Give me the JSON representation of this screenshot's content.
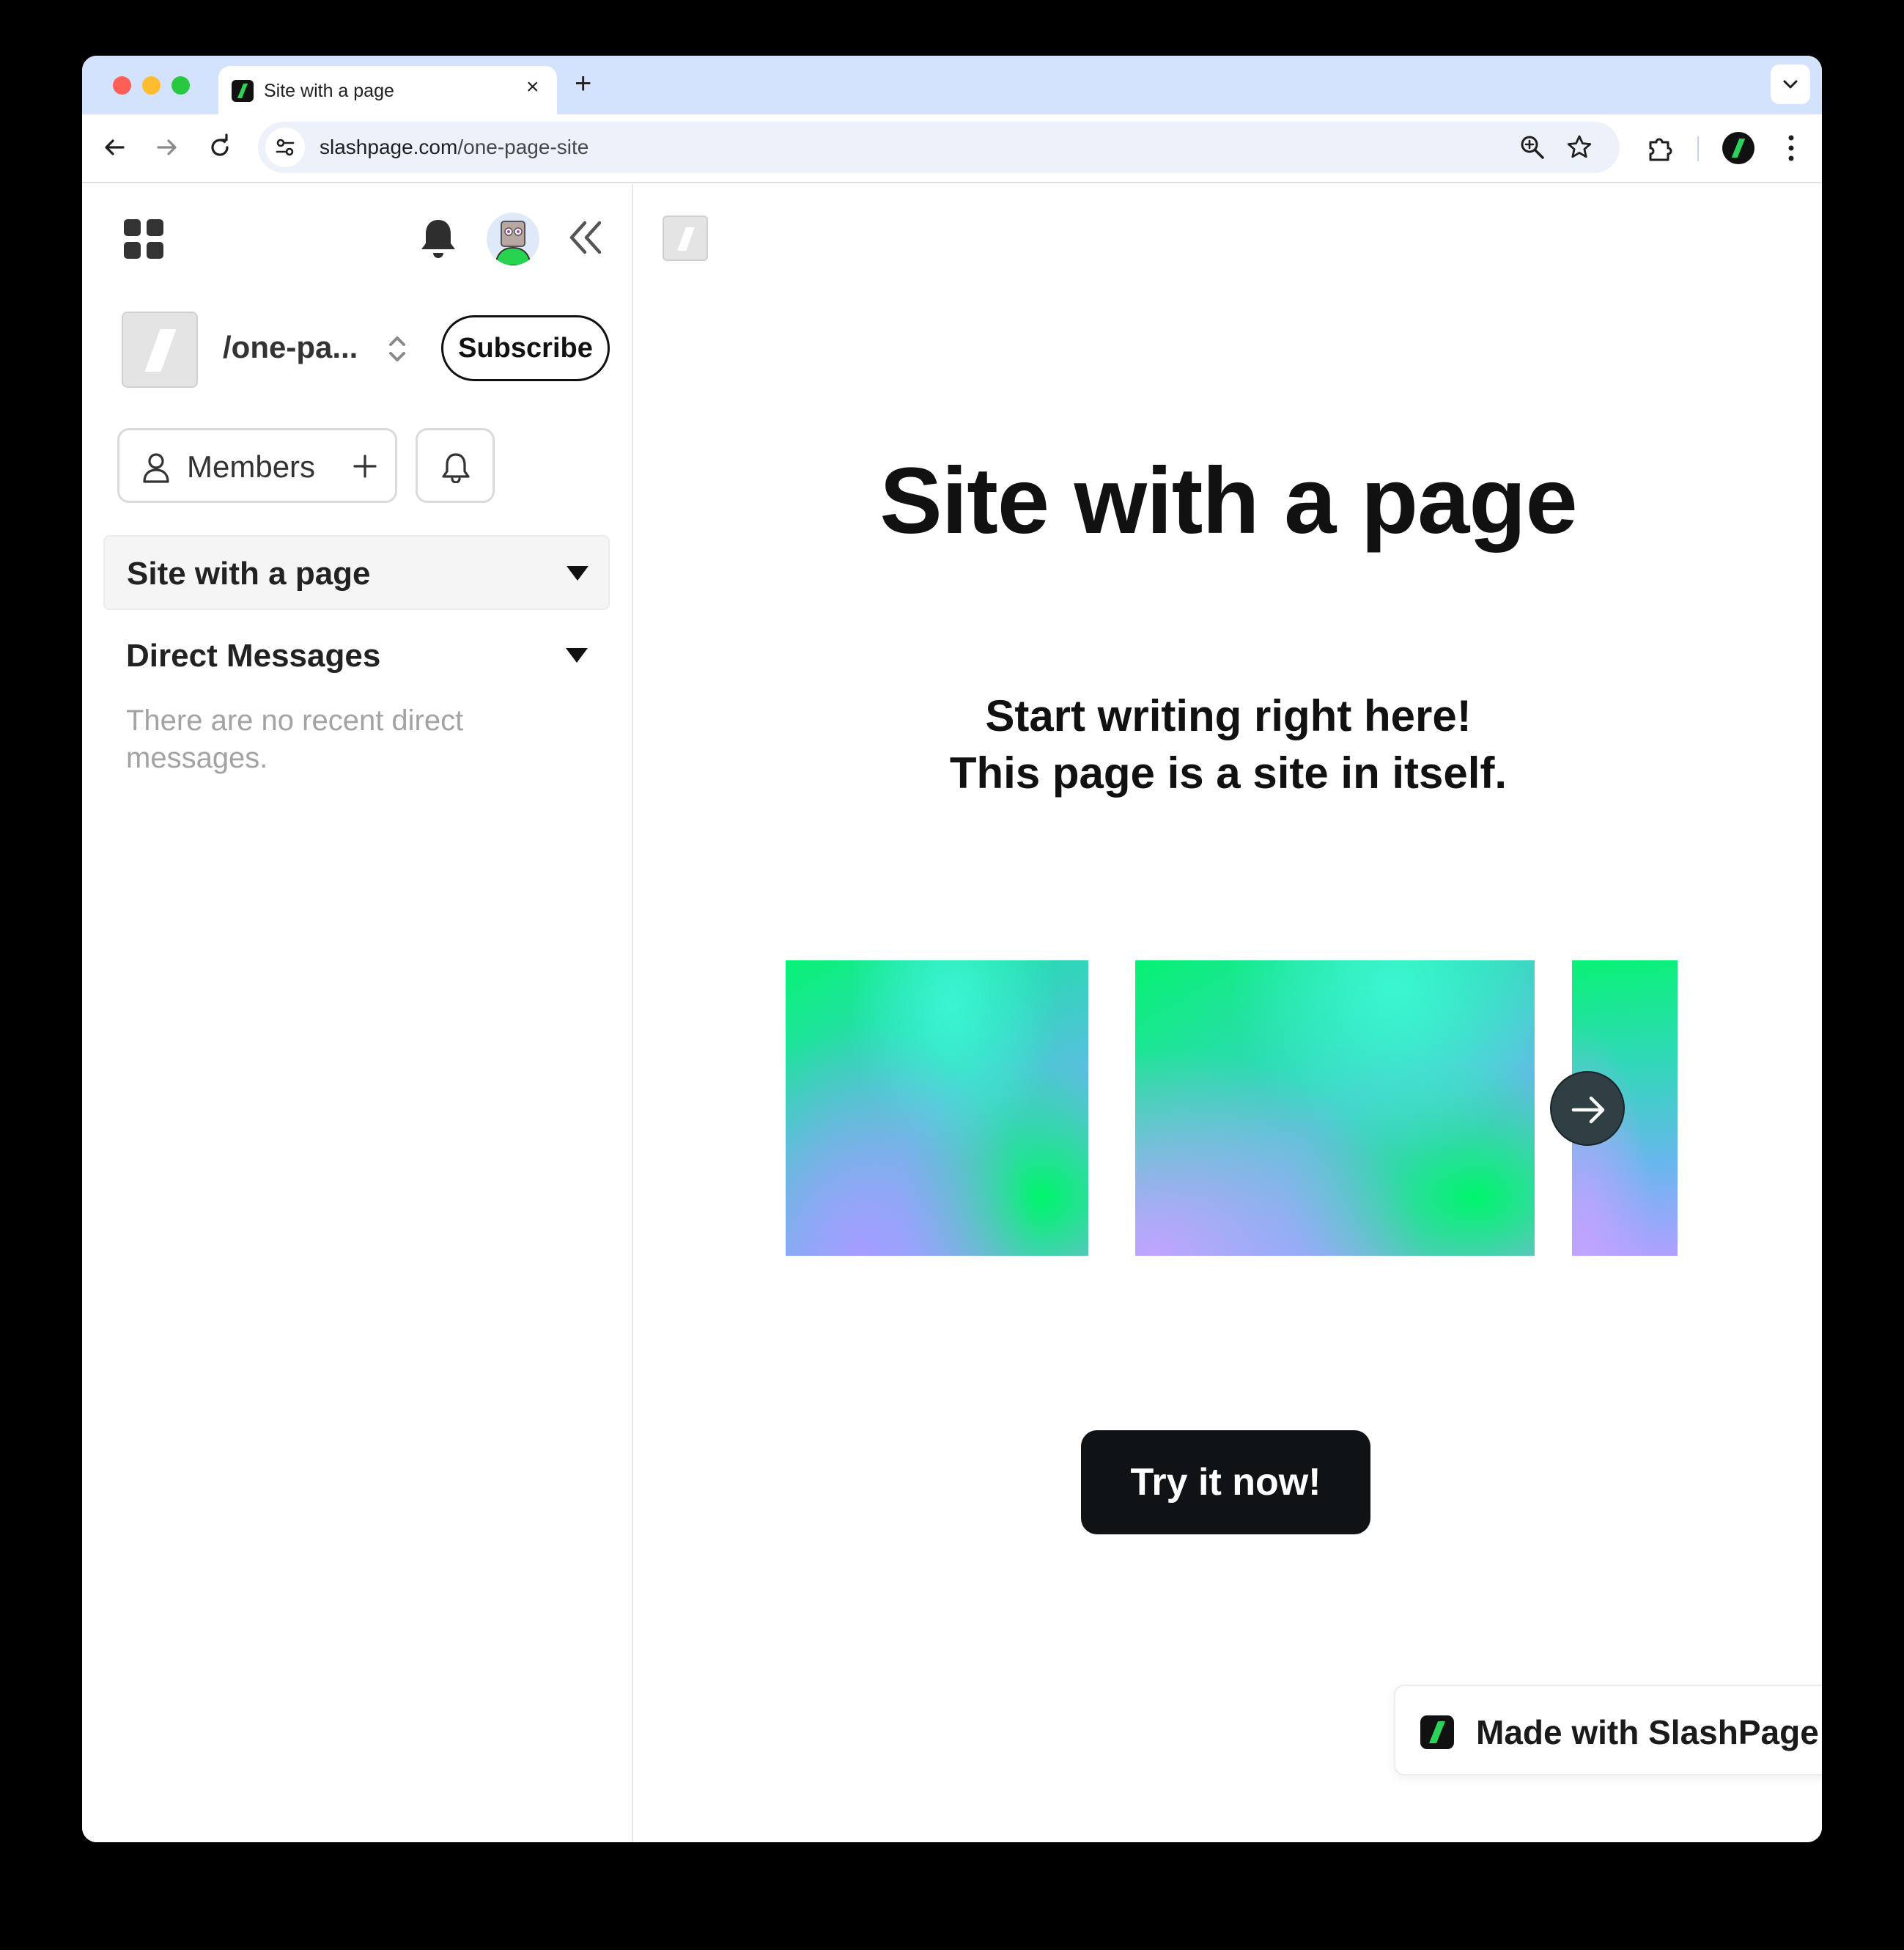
{
  "browser": {
    "tab_title": "Site with a page",
    "tab_close": "×",
    "new_tab": "+",
    "url_domain": "slashpage.com",
    "url_path": "/one-page-site"
  },
  "sidebar": {
    "site_name": "/one-pa...",
    "subscribe_label": "Subscribe",
    "members_label": "Members",
    "nav_site_label": "Site with a page",
    "dm_heading": "Direct Messages",
    "dm_empty": "There are no recent direct messages."
  },
  "main": {
    "title": "Site with a page",
    "subtitle_line1": "Start writing right here!",
    "subtitle_line2": "This page is a site in itself.",
    "cta_label": "Try it now!",
    "made_with": "Made with SlashPage"
  },
  "icons": {
    "apps": "apps-grid-icon",
    "bell": "bell-icon",
    "collapse": "double-chevron-left-icon",
    "switch": "chevron-up-down-icon",
    "user": "user-icon",
    "plus": "plus-icon",
    "carousel_next": "arrow-right-icon"
  },
  "colors": {
    "brand_green": "#2bd35a",
    "cta_bg": "#101316",
    "tabstrip_bg": "#d3e3fd"
  }
}
